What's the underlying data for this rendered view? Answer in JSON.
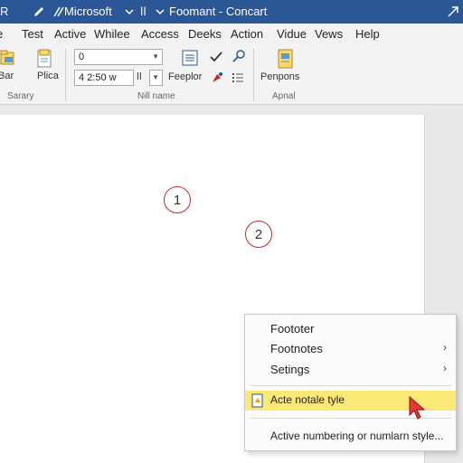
{
  "title_bar": {
    "app_letter": "R",
    "app_name": "Microsoft",
    "separator_a": "ǀǀ",
    "document_title": "Foomant - Concart"
  },
  "menu_bar": {
    "items": [
      "e",
      "Test",
      "Active",
      "Whilee",
      "Access",
      "Deeks",
      "Action",
      "Vidue",
      "Vews",
      "Help"
    ]
  },
  "ribbon": {
    "btn_left_label": "Bar",
    "btn_plica_label": "Plica",
    "group_left_label": "Sarary",
    "font_combo_value": "0",
    "size_combo_value": "4 2:50 w",
    "size_suffix": "ǀǀ",
    "feeplor_label": "Feeplor",
    "group_mid_label": "Nill name",
    "penpons_label": "Penpons",
    "group_right_label": "Apnal"
  },
  "document": {
    "marker_1": "1",
    "marker_2": "2"
  },
  "context_menu": {
    "items": [
      {
        "label": "Foototer",
        "submenu": false
      },
      {
        "label": "Footnotes",
        "submenu": true
      },
      {
        "label": "Setings",
        "submenu": true
      },
      {
        "label": "Acte notale tyle",
        "submenu": false,
        "highlighted": true
      },
      {
        "label": "Active numbering or numlarn style...",
        "submenu": false
      }
    ],
    "chevron": "›"
  },
  "colors": {
    "title_bar": "#2b5797",
    "highlight": "#fce876",
    "marker_ring": "#c62828",
    "cursor": "#e53935"
  }
}
